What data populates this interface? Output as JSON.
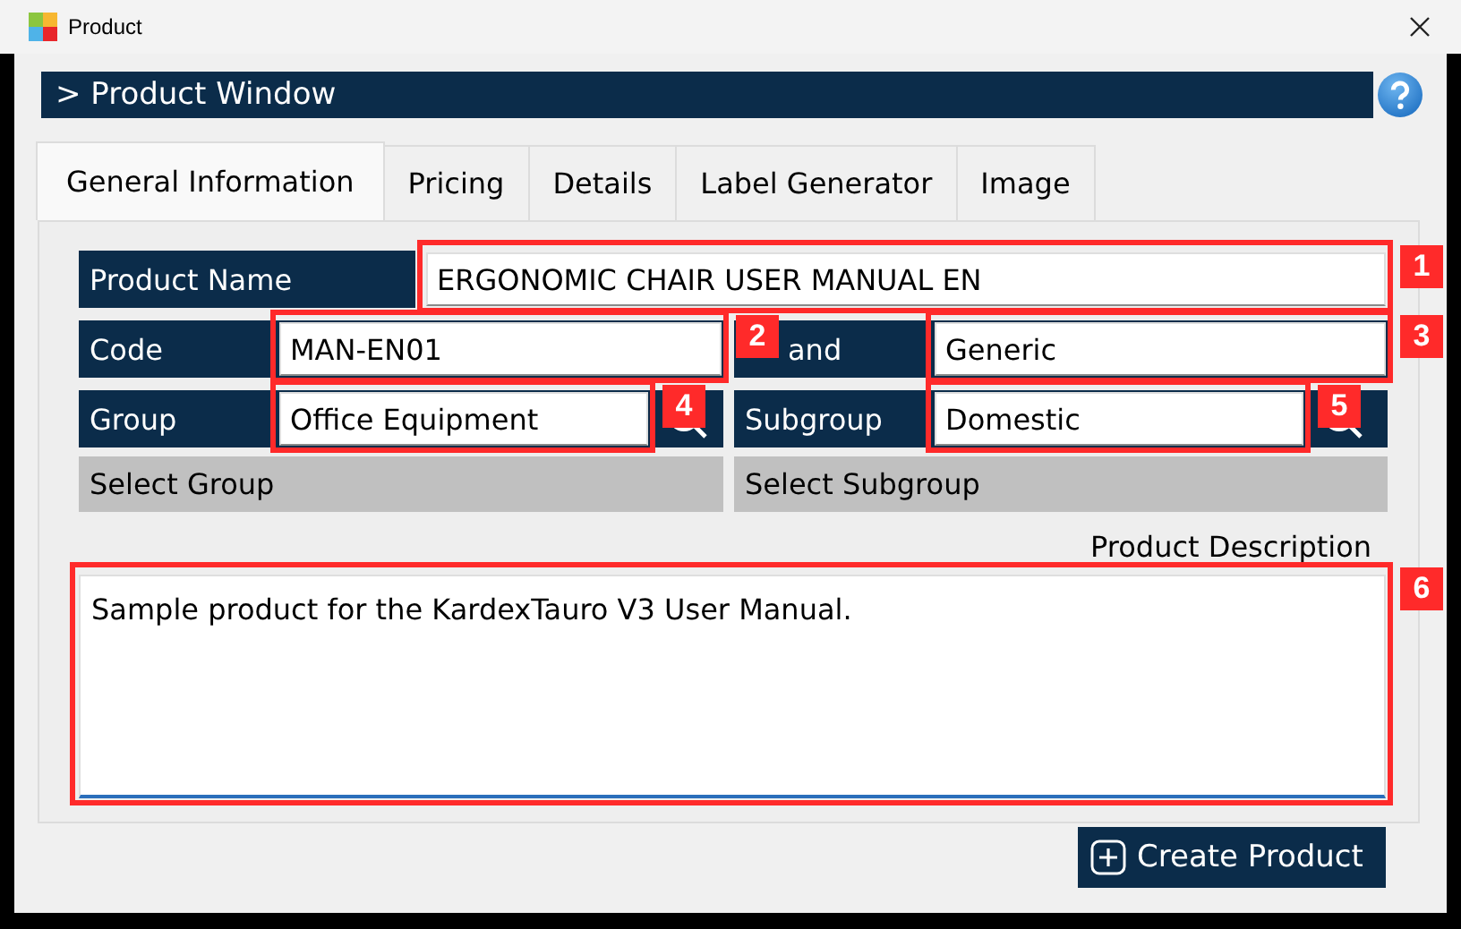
{
  "window": {
    "title": "Product"
  },
  "header": {
    "title": "> Product Window"
  },
  "tabs": [
    {
      "label": "General Information",
      "selected": true
    },
    {
      "label": "Pricing",
      "selected": false
    },
    {
      "label": "Details",
      "selected": false
    },
    {
      "label": "Label Generator",
      "selected": false
    },
    {
      "label": "Image",
      "selected": false
    }
  ],
  "product_name": {
    "label": "Product Name",
    "value": "ERGONOMIC CHAIR USER MANUAL EN",
    "callout": "1"
  },
  "rows": [
    [
      {
        "kind": "text",
        "label": "Code",
        "value": "MAN-EN01",
        "callout": "2"
      },
      {
        "kind": "text",
        "label": "and",
        "value": "Generic",
        "callout": "3"
      }
    ],
    [
      {
        "kind": "lookup",
        "label": "Group",
        "value": "Office Equipment",
        "callout": "4",
        "select_label": "Select Group"
      },
      {
        "kind": "lookup",
        "label": "Subgroup",
        "value": "Domestic",
        "callout": "5",
        "select_label": "Select Subgroup"
      }
    ]
  ],
  "description": {
    "label": "Product Description",
    "value": "Sample product for the KardexTauro V3 User Manual.",
    "callout": "6"
  },
  "create_button": {
    "label": "Create Product"
  }
}
